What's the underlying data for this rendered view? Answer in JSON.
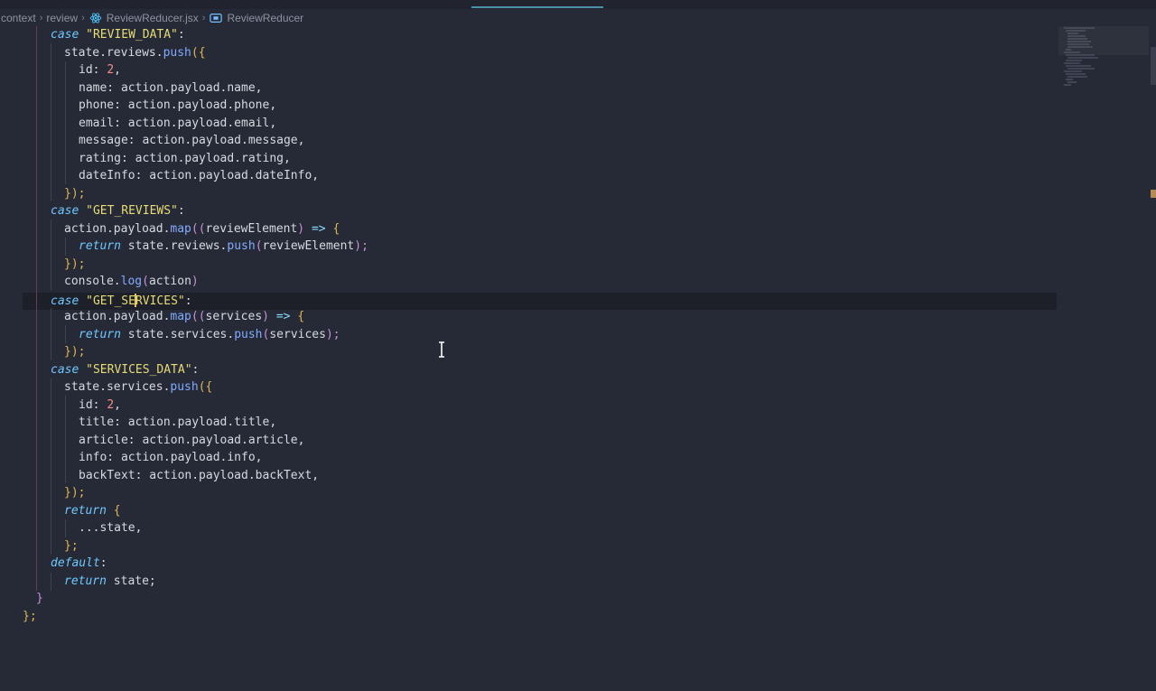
{
  "breadcrumb": {
    "items": [
      "context",
      "review",
      "ReviewReducer.jsx",
      "ReviewReducer"
    ]
  },
  "colors": {
    "background": "#262a36",
    "keyword": "#6fc7ff",
    "string": "#e6db74",
    "number": "#f58c89",
    "function": "#82aaff",
    "brace": "#e0b552",
    "cursor": "#e8c45a"
  },
  "icons": [
    "react-icon",
    "symbol-class-icon",
    "chevron-right-icon",
    "text-cursor-icon"
  ],
  "code": {
    "l1": {
      "kw": "case",
      "str": "\"REVIEW_DATA\"",
      "rest": ":"
    },
    "l2": {
      "obj": "state.reviews.",
      "fn": "push",
      "open": "({"
    },
    "l3": {
      "key": "id: ",
      "num": "2",
      "rest": ","
    },
    "l4": "name: action.payload.name,",
    "l5": "phone: action.payload.phone,",
    "l6": "email: action.payload.email,",
    "l7": "message: action.payload.message,",
    "l8": "rating: action.payload.rating,",
    "l9": "dateInfo: action.payload.dateInfo,",
    "l10": {
      "close": "});"
    },
    "l11": {
      "kw": "case",
      "str": "\"GET_REVIEWS\"",
      "rest": ":"
    },
    "l12": {
      "obj": "action.payload.",
      "fn": "map",
      "open": "((",
      "arg": "reviewElement",
      "close": ")",
      "arrow": " => ",
      "brace": "{"
    },
    "l13": {
      "kw": "return",
      "obj": " state.reviews.",
      "fn": "push",
      "open": "(",
      "arg": "reviewElement",
      "close": ");"
    },
    "l14": {
      "close": "});"
    },
    "l15": {
      "obj": "console.",
      "fn": "log",
      "open": "(",
      "arg": "action",
      "close": ")"
    },
    "l16": {
      "kw": "case",
      "str_a": "\"GET_SE",
      "str_b": "RVICES\"",
      "rest": ":"
    },
    "l17": {
      "obj": "action.payload.",
      "fn": "map",
      "open": "((",
      "arg": "services",
      "close": ")",
      "arrow": " => ",
      "brace": "{"
    },
    "l18": {
      "kw": "return",
      "obj": " state.services.",
      "fn": "push",
      "open": "(",
      "arg": "services",
      "close": ");"
    },
    "l19": {
      "close": "});"
    },
    "l20": {
      "kw": "case",
      "str": "\"SERVICES_DATA\"",
      "rest": ":"
    },
    "l21": {
      "obj": "state.services.",
      "fn": "push",
      "open": "({"
    },
    "l22": {
      "key": "id: ",
      "num": "2",
      "rest": ","
    },
    "l23": "title: action.payload.title,",
    "l24": "article: action.payload.article,",
    "l25": "info: action.payload.info,",
    "l26": "backText: action.payload.backText,",
    "l27": {
      "close": "});"
    },
    "l28": {
      "kw": "return",
      "brace": " {"
    },
    "l29": "...state,",
    "l30": {
      "close": "};"
    },
    "l31": {
      "kw": "default",
      "rest": ":"
    },
    "l32": {
      "kw": "return",
      "rest": " state;"
    },
    "l33": "}",
    "l34": "};"
  }
}
